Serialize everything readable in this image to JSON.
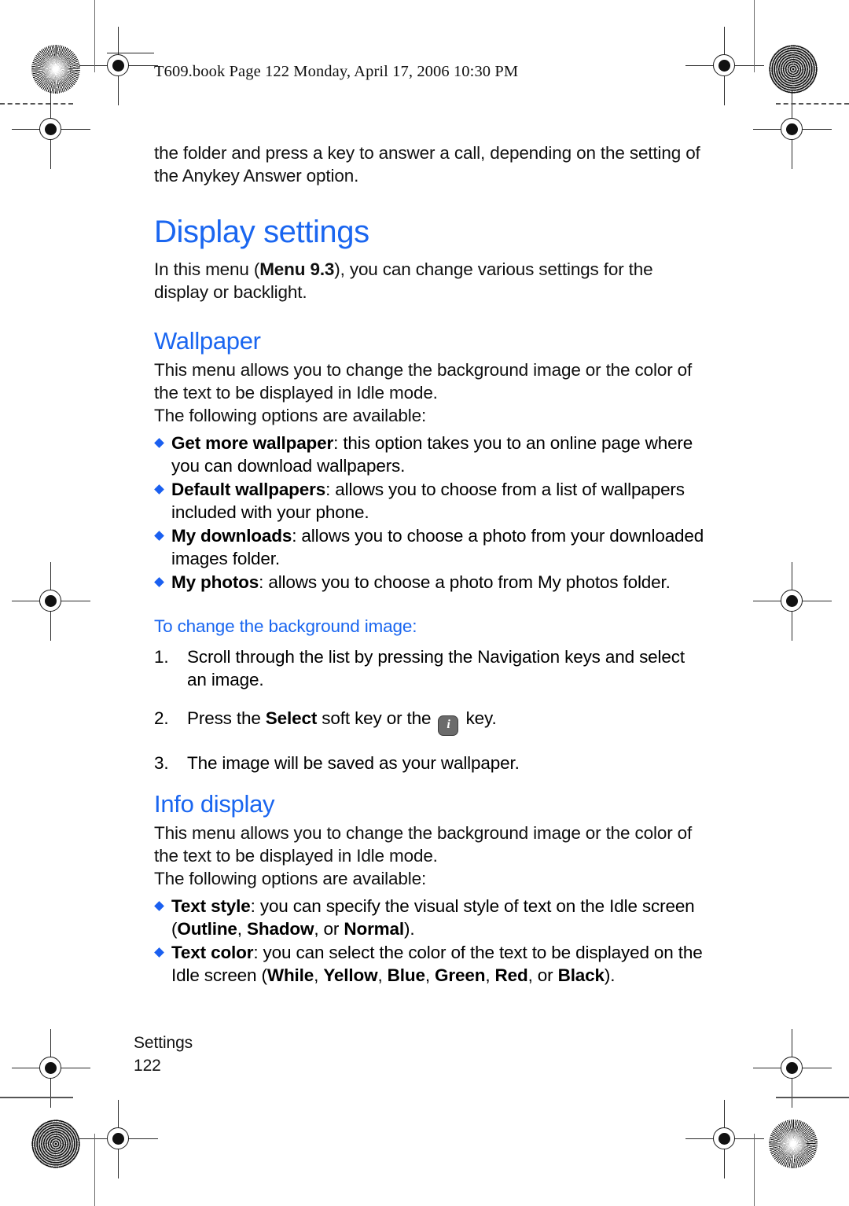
{
  "running_head": "T609.book  Page 122  Monday, April 17, 2006  10:30 PM",
  "intro": {
    "continued_paragraph": "the folder and press a key to answer a call, depending on the setting of the Anykey Answer option."
  },
  "display_settings": {
    "heading": "Display settings",
    "intro_pre": "In this menu (",
    "intro_menu_ref": "Menu 9.3",
    "intro_post": "), you can change various settings for the display or backlight."
  },
  "wallpaper": {
    "heading": "Wallpaper",
    "paragraph1": "This menu allows you to change the background image or the color of the text to be displayed in Idle mode.",
    "paragraph2": "The following options are available:",
    "options": [
      {
        "term": "Get more wallpaper",
        "desc": ": this option takes you to an online page where you can download wallpapers."
      },
      {
        "term": "Default wallpapers",
        "desc": ": allows you to choose from a list of wallpapers included with your phone."
      },
      {
        "term": "My downloads",
        "desc": ": allows you to choose a photo from your downloaded images folder."
      },
      {
        "term": "My photos",
        "desc": ": allows you to choose a photo from My photos folder."
      }
    ],
    "procedure_heading": "To change the background image:",
    "steps": [
      {
        "num": "1.",
        "pre": "Scroll through the list by pressing the Navigation keys and select an image.",
        "bold": "",
        "post": ""
      },
      {
        "num": "2.",
        "pre": "Press the ",
        "bold": "Select",
        "post": " soft key or the ",
        "icon": "i-key-icon",
        "tail": " key."
      },
      {
        "num": "3.",
        "pre": "The image will be saved as your wallpaper.",
        "bold": "",
        "post": ""
      }
    ]
  },
  "info_display": {
    "heading": "Info display",
    "paragraph1": "This menu allows you to change the background image or the color of the text to be displayed in Idle mode.",
    "paragraph2": "The following options are available:",
    "options": [
      {
        "term": "Text style",
        "desc_a": ": you can specify the visual style of text on the Idle screen (",
        "values": [
          "Outline",
          "Shadow",
          "Normal"
        ],
        "sep": ", ",
        "last_sep": ", or ",
        "desc_b": ")."
      },
      {
        "term": "Text color",
        "desc_a": ": you can select the color of the text to be displayed on the Idle screen (",
        "values": [
          "While",
          "Yellow",
          "Blue",
          "Green",
          "Red",
          "Black"
        ],
        "sep": ", ",
        "last_sep": ", or ",
        "desc_b": ")."
      }
    ]
  },
  "footer": {
    "section": "Settings",
    "page_number": "122"
  },
  "colors": {
    "heading_blue": "#1a66f0",
    "bullet_blue": "#1a5ff0",
    "text": "#111111",
    "key_icon_bg": "#6b6b6b"
  }
}
